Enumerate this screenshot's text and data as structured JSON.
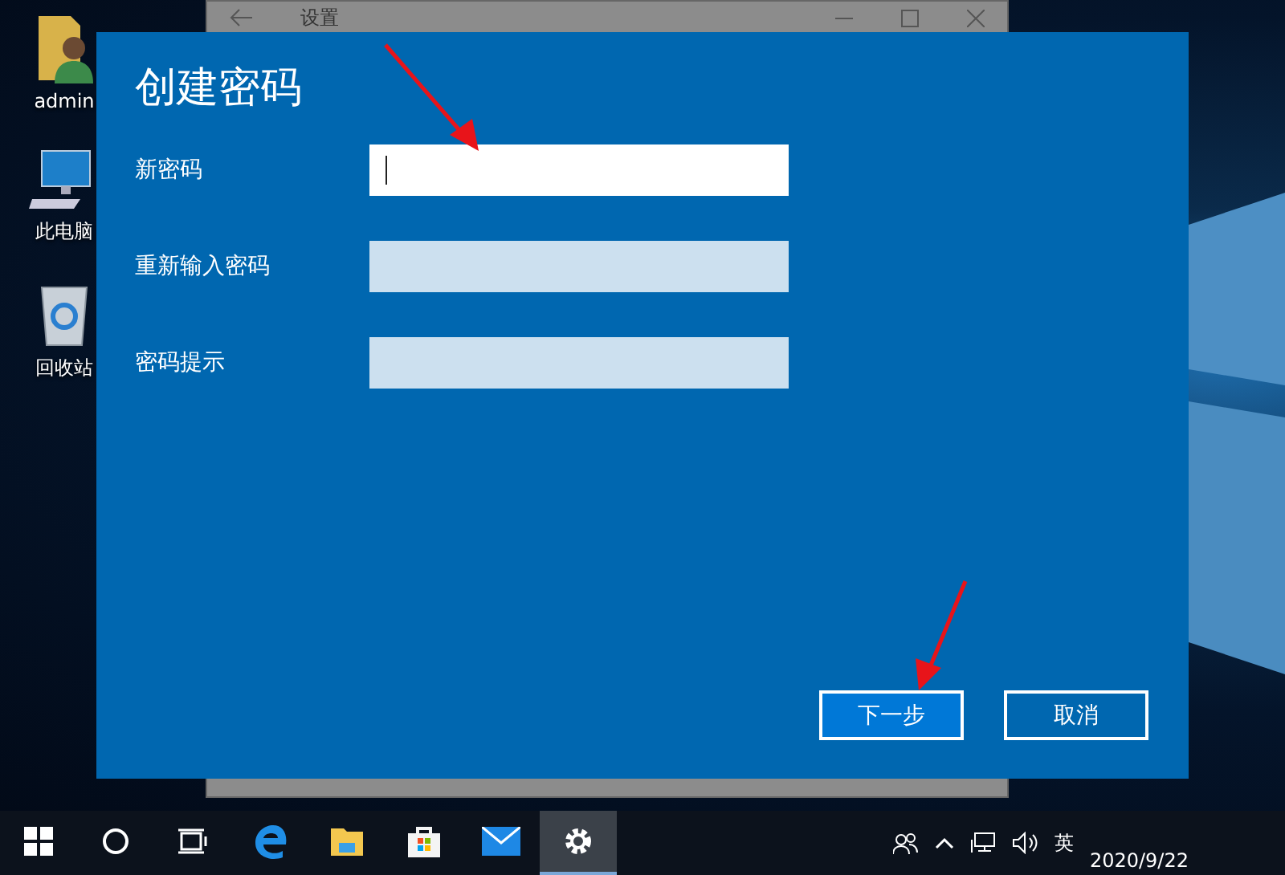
{
  "desktop_icons": [
    {
      "kind": "user",
      "label": "admin"
    },
    {
      "kind": "computer",
      "label": "此电脑"
    },
    {
      "kind": "recycle",
      "label": "回收站"
    }
  ],
  "settings_window": {
    "title": "设置"
  },
  "dialog": {
    "title": "创建密码",
    "fields": [
      {
        "label": "新密码",
        "focused": true
      },
      {
        "label": "重新输入密码",
        "focused": false
      },
      {
        "label": "密码提示",
        "focused": false
      }
    ],
    "buttons": [
      {
        "label": "下一步",
        "kind": "primary"
      },
      {
        "label": "取消",
        "kind": "secondary"
      }
    ]
  },
  "taskbar": {
    "apps": [
      {
        "kind": "start",
        "selected": false
      },
      {
        "kind": "search",
        "selected": false
      },
      {
        "kind": "taskview",
        "selected": false
      },
      {
        "kind": "edge",
        "selected": false
      },
      {
        "kind": "explorer",
        "selected": false
      },
      {
        "kind": "store",
        "selected": false
      },
      {
        "kind": "mail",
        "selected": false
      },
      {
        "kind": "settings",
        "selected": true
      }
    ],
    "input_language": "英",
    "date": "2020/9/22"
  }
}
